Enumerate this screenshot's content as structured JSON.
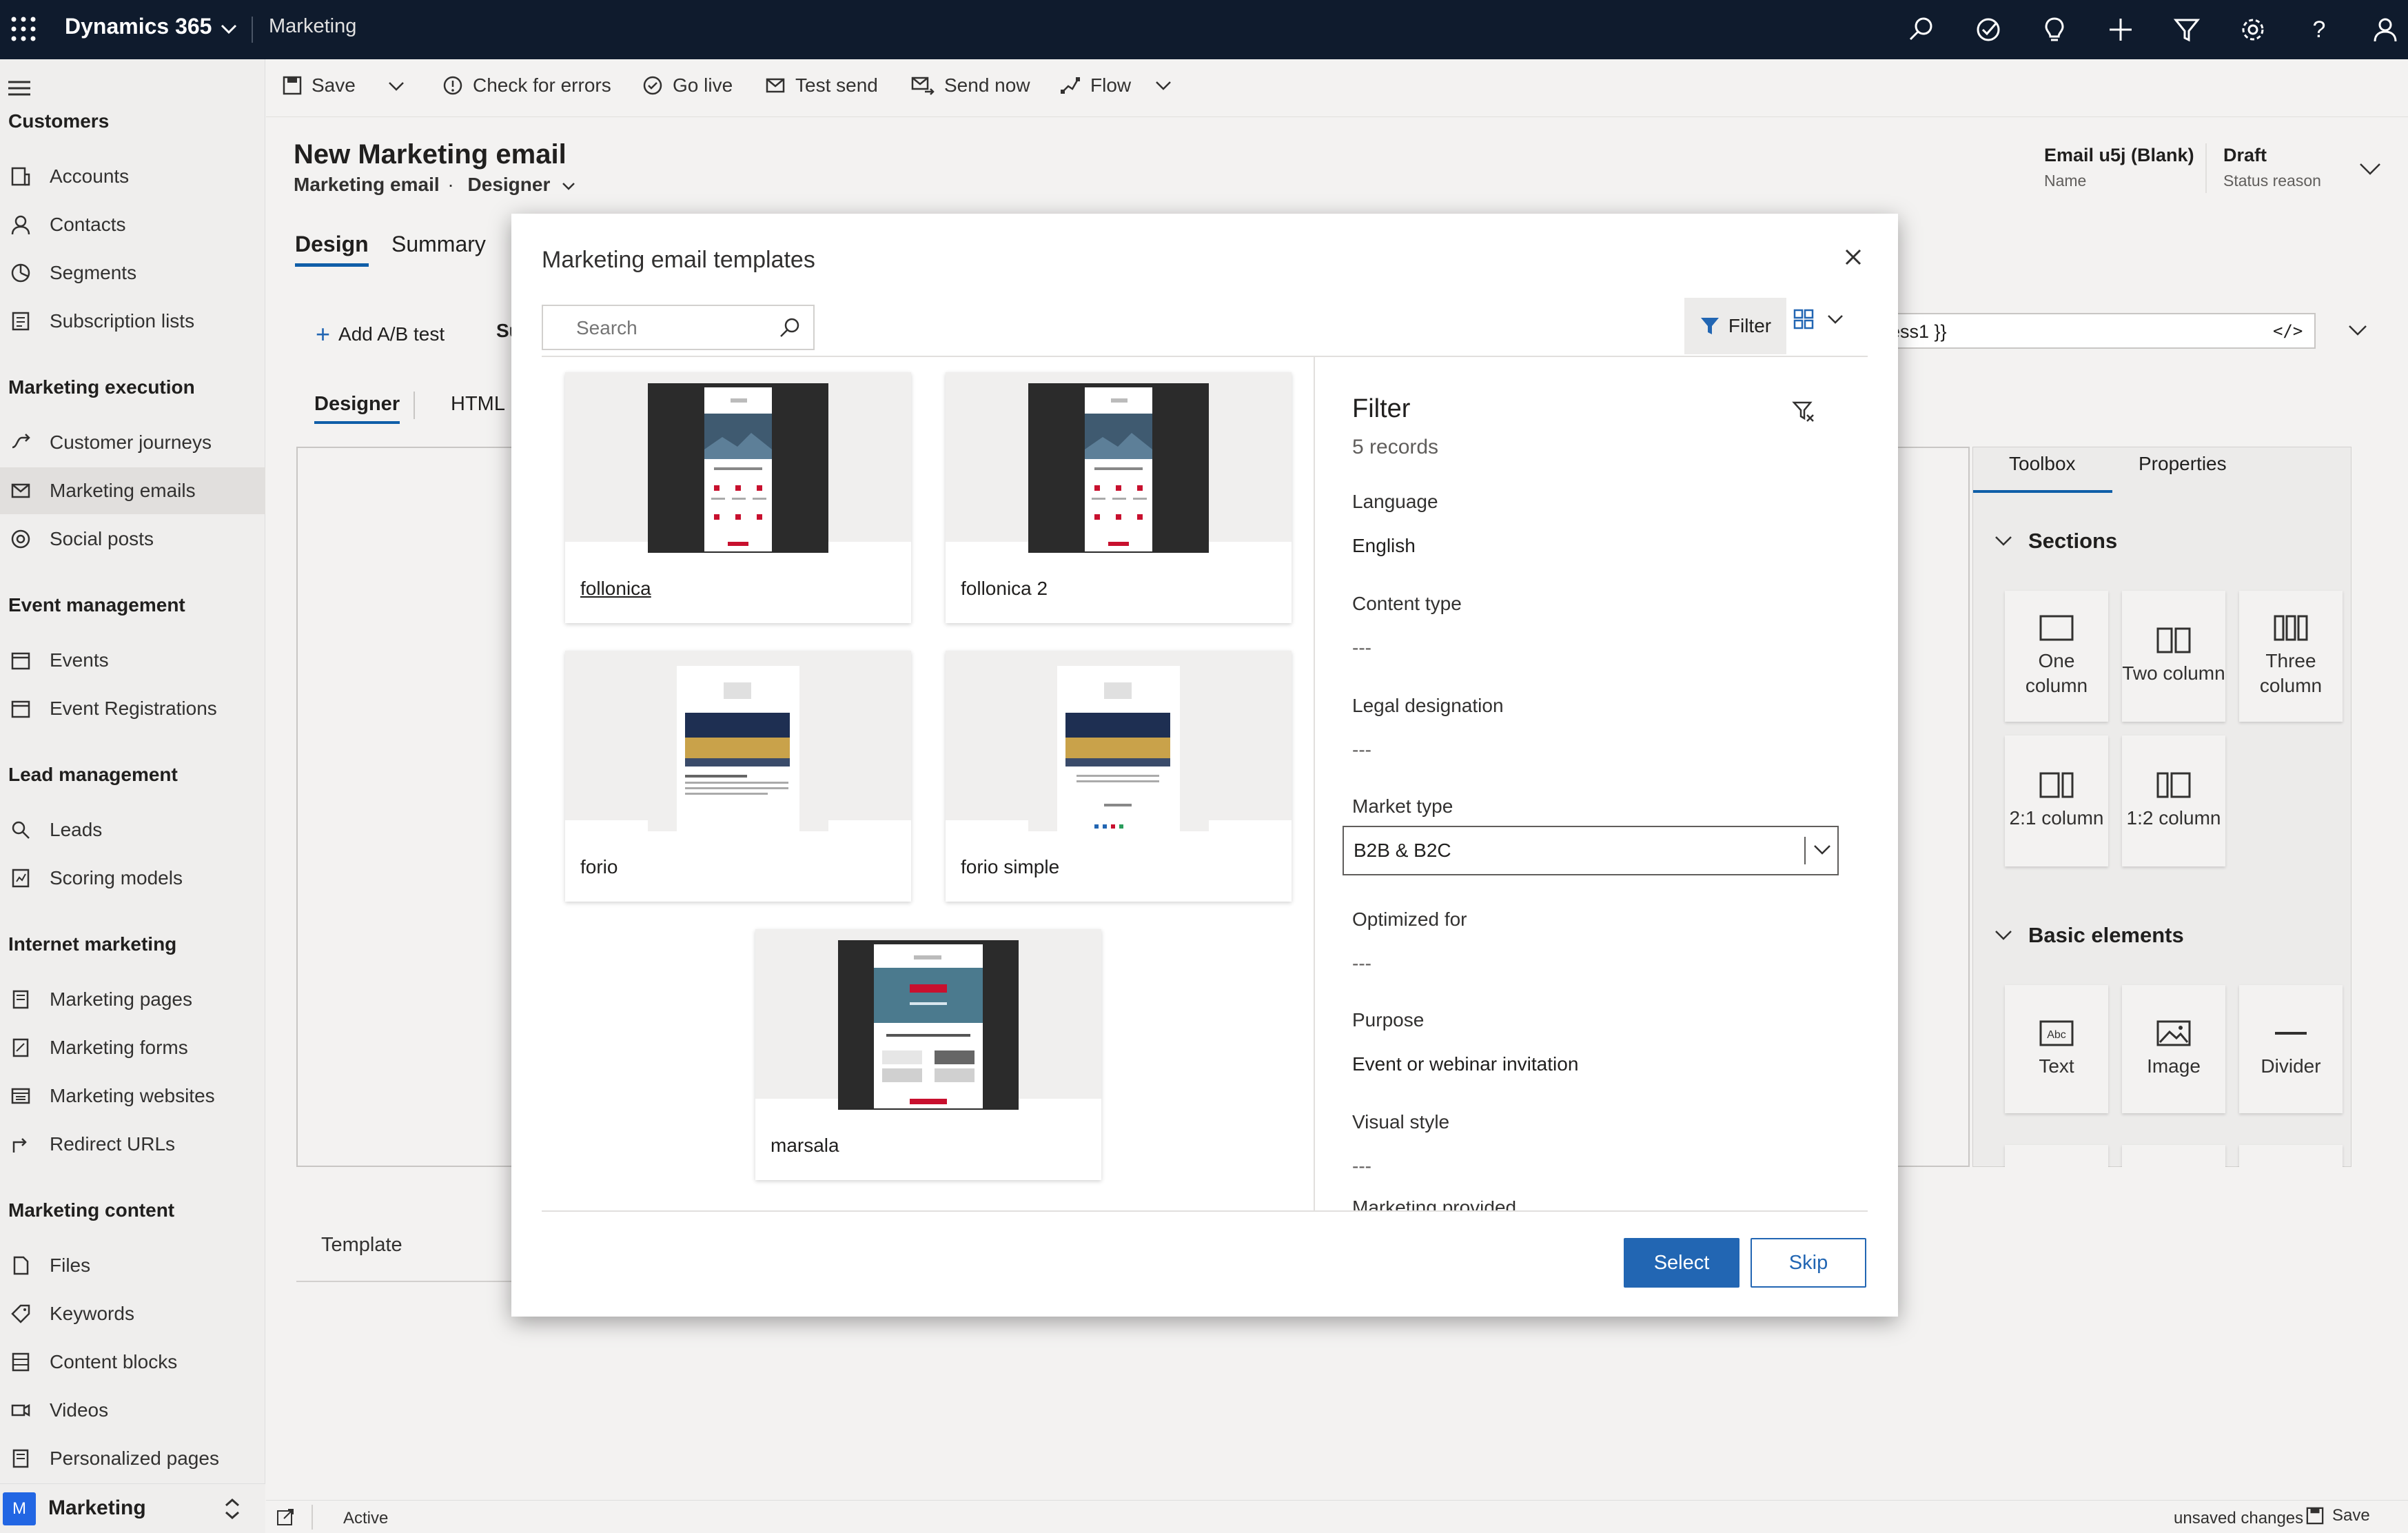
{
  "topbar": {
    "app_name": "Dynamics 365",
    "module": "Marketing",
    "icons": [
      "search-icon",
      "task-icon",
      "lightbulb-icon",
      "plus-icon",
      "filter-icon",
      "gear-icon",
      "help-icon",
      "user-icon"
    ]
  },
  "sidebar": {
    "groups": [
      {
        "title": "Customers",
        "items": [
          {
            "label": "Accounts",
            "icon": "accounts-icon"
          },
          {
            "label": "Contacts",
            "icon": "contacts-icon"
          },
          {
            "label": "Segments",
            "icon": "segments-icon"
          },
          {
            "label": "Subscription lists",
            "icon": "subscription-lists-icon"
          }
        ]
      },
      {
        "title": "Marketing execution",
        "items": [
          {
            "label": "Customer journeys",
            "icon": "journey-icon"
          },
          {
            "label": "Marketing emails",
            "icon": "email-icon",
            "active": true
          },
          {
            "label": "Social posts",
            "icon": "social-icon"
          }
        ]
      },
      {
        "title": "Event management",
        "items": [
          {
            "label": "Events",
            "icon": "calendar-icon"
          },
          {
            "label": "Event Registrations",
            "icon": "calendar-icon"
          }
        ]
      },
      {
        "title": "Lead management",
        "items": [
          {
            "label": "Leads",
            "icon": "leads-icon"
          },
          {
            "label": "Scoring models",
            "icon": "scoring-icon"
          }
        ]
      },
      {
        "title": "Internet marketing",
        "items": [
          {
            "label": "Marketing pages",
            "icon": "page-icon"
          },
          {
            "label": "Marketing forms",
            "icon": "form-icon"
          },
          {
            "label": "Marketing websites",
            "icon": "website-icon"
          },
          {
            "label": "Redirect URLs",
            "icon": "redirect-icon"
          }
        ]
      },
      {
        "title": "Marketing content",
        "items": [
          {
            "label": "Files",
            "icon": "file-icon"
          },
          {
            "label": "Keywords",
            "icon": "tag-icon"
          },
          {
            "label": "Content blocks",
            "icon": "blocks-icon"
          },
          {
            "label": "Videos",
            "icon": "video-icon"
          },
          {
            "label": "Personalized pages",
            "icon": "page-icon"
          }
        ]
      }
    ],
    "area": {
      "badge": "M",
      "label": "Marketing"
    }
  },
  "commandbar": {
    "save": "Save",
    "check_errors": "Check for errors",
    "go_live": "Go live",
    "test_send": "Test send",
    "send_now": "Send now",
    "flow": "Flow"
  },
  "form": {
    "title": "New Marketing email",
    "entity": "Marketing email",
    "form_selector": "Designer",
    "name_value": "Email u5j (Blank)",
    "name_label": "Name",
    "status_value": "Draft",
    "status_label": "Status reason",
    "tabs": [
      "Design",
      "Summary"
    ],
    "add_ab": "Add A/B test",
    "subject_partial": "Su",
    "address_partial": "ess1 }}",
    "sub_tabs": [
      "Designer",
      "HTML"
    ],
    "template_label": "Template"
  },
  "toolbox": {
    "tabs": [
      "Toolbox",
      "Properties"
    ],
    "sections_title": "Sections",
    "sections": [
      "One column",
      "Two column",
      "Three column",
      "2:1 column",
      "1:2 column"
    ],
    "basic_title": "Basic elements",
    "basic": [
      "Text",
      "Image",
      "Divider"
    ]
  },
  "modal": {
    "title": "Marketing email templates",
    "search_placeholder": "Search",
    "filter_label": "Filter",
    "templates": [
      {
        "name": "follonica",
        "style": "dark"
      },
      {
        "name": "follonica 2",
        "style": "dark"
      },
      {
        "name": "forio",
        "style": "light"
      },
      {
        "name": "forio simple",
        "style": "light"
      },
      {
        "name": "marsala",
        "style": "marsala"
      }
    ],
    "filter_panel": {
      "title": "Filter",
      "records": "5 records",
      "language_label": "Language",
      "language_value": "English",
      "content_type_label": "Content type",
      "content_type_value": "---",
      "legal_label": "Legal designation",
      "legal_value": "---",
      "market_label": "Market type",
      "market_value": "B2B & B2C",
      "optimized_label": "Optimized for",
      "optimized_value": "---",
      "purpose_label": "Purpose",
      "purpose_value": "Event or webinar invitation",
      "visual_label": "Visual style",
      "visual_value": "---",
      "more_label": "Marketing provided"
    },
    "select_button": "Select",
    "skip_button": "Skip"
  },
  "statusbar": {
    "status": "Active",
    "unsaved": "unsaved changes",
    "save": "Save"
  }
}
